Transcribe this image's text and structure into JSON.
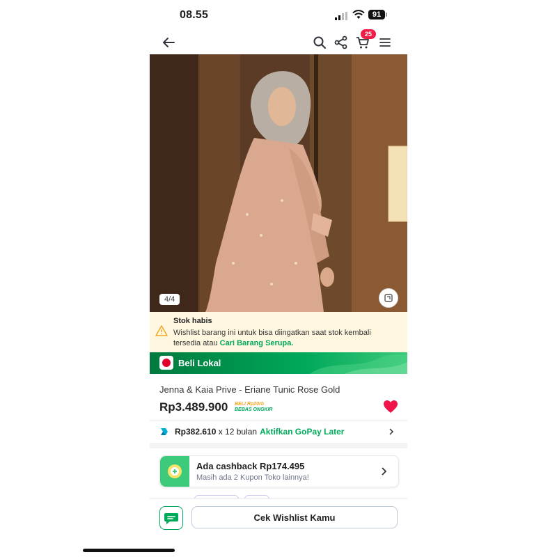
{
  "status_bar": {
    "time": "08.55",
    "battery": "91"
  },
  "nav": {
    "cart_count": "25"
  },
  "gallery": {
    "counter": "4/4"
  },
  "stock_notice": {
    "title": "Stok habis",
    "message": "Wishlist barang ini untuk bisa diingatkan saat stok kembali tersedia atau ",
    "link": "Cari Barang Serupa."
  },
  "banner": {
    "label": "Beli Lokal"
  },
  "product": {
    "title": "Jenna & Kaia Prive - Eriane Tunic Rose Gold",
    "price": "Rp3.489.900",
    "ongkir_line1": "BELI Rp20rb",
    "ongkir_line2": "BEBAS ONGKIR"
  },
  "gopay": {
    "amount": "Rp382.610",
    "tenor": "x 12 bulan",
    "action": "Aktifkan GoPay Later"
  },
  "cashback": {
    "title": "Ada cashback Rp174.495",
    "subtitle": "Masih ada 2 Kupon Toko lainnya!"
  },
  "bottom_bar": {
    "wishlist_button": "Cek Wishlist Kamu"
  },
  "colors": {
    "accent_green": "#00aa5b",
    "badge_red": "#ef1e48",
    "heart_red": "#ef144a"
  }
}
